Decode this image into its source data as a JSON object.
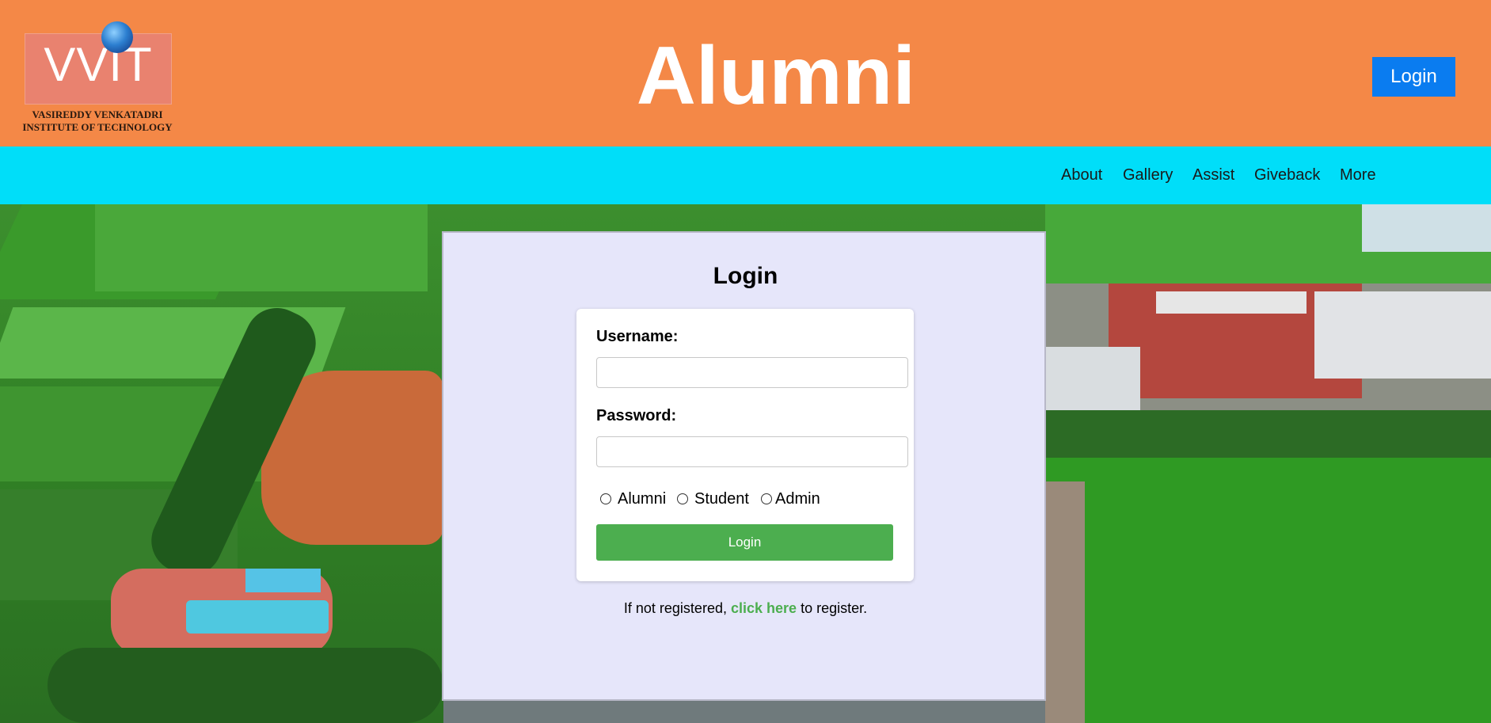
{
  "header": {
    "logo_text": "VVIT",
    "logo_subtitle": "VASIREDDY VENKATADRI\nINSTITUTE OF TECHNOLOGY",
    "title": "Alumni",
    "login_button": "Login"
  },
  "nav": {
    "items": [
      {
        "label": "About"
      },
      {
        "label": "Gallery"
      },
      {
        "label": "Assist"
      },
      {
        "label": "Giveback"
      },
      {
        "label": "More"
      }
    ]
  },
  "login_form": {
    "title": "Login",
    "username_label": "Username:",
    "username_value": "",
    "password_label": "Password:",
    "password_value": "",
    "roles": [
      {
        "label": "Alumni",
        "selected": false
      },
      {
        "label": "Student",
        "selected": false
      },
      {
        "label": "Admin",
        "selected": false
      }
    ],
    "submit_label": "Login",
    "register_prefix": "If not registered,",
    "register_link": "click here",
    "register_suffix": "to register."
  },
  "colors": {
    "header_bg": "#f48847",
    "nav_bg": "#00def9",
    "login_button_bg": "#0a7cf0",
    "panel_bg": "#e6e6fa",
    "submit_bg": "#4cae4f",
    "link_color": "#4cae4f"
  }
}
